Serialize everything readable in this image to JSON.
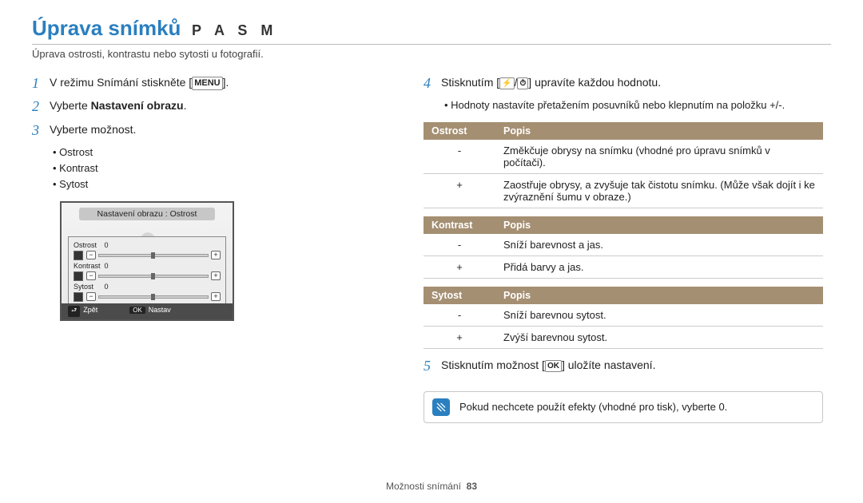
{
  "header": {
    "title": "Úprava snímků",
    "modes": "P A S M",
    "subtitle": "Úprava ostrosti, kontrastu nebo sytosti u fotografií."
  },
  "left": {
    "step1": "V režimu Snímání stiskněte [",
    "step1_icon": "MENU",
    "step1_end": "].",
    "step2_pre": "Vyberte ",
    "step2_bold": "Nastavení obrazu",
    "step2_post": ".",
    "step3": "Vyberte možnost.",
    "options": [
      "Ostrost",
      "Kontrast",
      "Sytost"
    ],
    "camera": {
      "title": "Nastavení obrazu : Ostrost",
      "rows": [
        {
          "label": "Ostrost",
          "val": "0"
        },
        {
          "label": "Kontrast",
          "val": "0"
        },
        {
          "label": "Sytost",
          "val": "0"
        }
      ],
      "back_btn": "⮐",
      "back_label": "Zpět",
      "ok_btn": "OK",
      "ok_label": "Nastav"
    }
  },
  "right": {
    "step4_a": "Stisknutím [",
    "step4_icon1": "⚡",
    "step4_sep": "/",
    "step4_icon2": "⏱",
    "step4_b": "] upravíte každou hodnotu.",
    "step4_bullet": "Hodnoty nastavíte přetažením posuvníků nebo klepnutím na položku +/-.",
    "tables": [
      {
        "h1": "Ostrost",
        "h2": "Popis",
        "rows": [
          {
            "sym": "-",
            "txt": "Změkčuje obrysy na snímku (vhodné pro úpravu snímků v počítači)."
          },
          {
            "sym": "+",
            "txt": "Zaostřuje obrysy, a zvyšuje tak čistotu snímku. (Může však dojít i ke zvýraznění šumu v obraze.)"
          }
        ]
      },
      {
        "h1": "Kontrast",
        "h2": "Popis",
        "rows": [
          {
            "sym": "-",
            "txt": "Sníží barevnost a jas."
          },
          {
            "sym": "+",
            "txt": "Přidá barvy a jas."
          }
        ]
      },
      {
        "h1": "Sytost",
        "h2": "Popis",
        "rows": [
          {
            "sym": "-",
            "txt": "Sníží barevnou sytost."
          },
          {
            "sym": "+",
            "txt": "Zvýší barevnou sytost."
          }
        ]
      }
    ],
    "step5_a": "Stisknutím možnost [",
    "step5_icon": "OK",
    "step5_b": "] uložíte nastavení.",
    "info": "Pokud nechcete použít efekty (vhodné pro tisk), vyberte 0."
  },
  "footer": {
    "label": "Možnosti snímání",
    "page": "83"
  }
}
